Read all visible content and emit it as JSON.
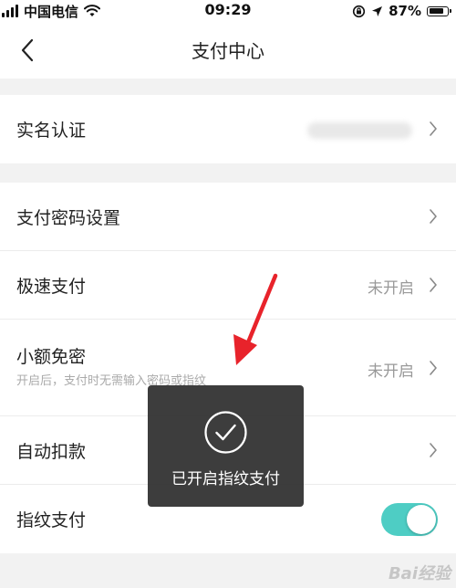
{
  "status_bar": {
    "carrier": "中国电信",
    "time": "09:29",
    "battery_percent": "87%",
    "battery_level": 0.87,
    "icons": [
      "signal-icon",
      "wifi-icon",
      "rotation-lock-icon",
      "location-icon",
      "battery-icon"
    ]
  },
  "nav": {
    "title": "支付中心",
    "back_icon": "chevron-left-icon"
  },
  "groups": [
    {
      "rows": [
        {
          "label": "实名认证",
          "value_obscured": true,
          "chevron": true
        }
      ]
    },
    {
      "rows": [
        {
          "label": "支付密码设置",
          "chevron": true
        },
        {
          "label": "极速支付",
          "value": "未开启",
          "chevron": true
        },
        {
          "label": "小额免密",
          "subtitle": "开启后，支付时无需输入密码或指纹",
          "value": "未开启",
          "chevron": true
        },
        {
          "label": "自动扣款",
          "chevron": true
        },
        {
          "label": "指纹支付",
          "toggle_on": true
        }
      ]
    }
  ],
  "toast": {
    "text": "已开启指纹支付",
    "icon": "check-circle-icon"
  },
  "colors": {
    "accent_toggle": "#4ecdc4",
    "annotation_arrow": "#e8232b",
    "toast_bg": "#2d2d2d",
    "page_bg": "#f2f2f2"
  },
  "watermark": "Bai经验"
}
